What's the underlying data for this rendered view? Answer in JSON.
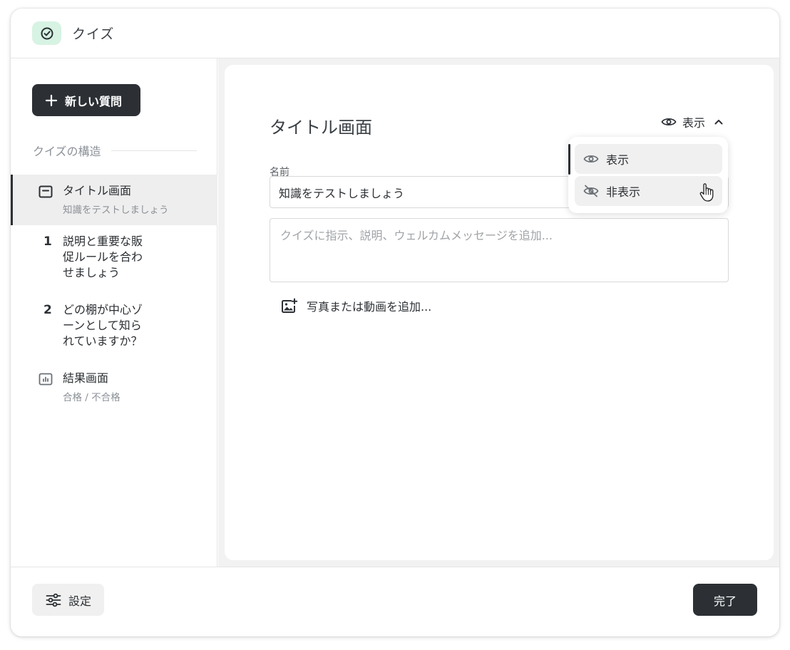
{
  "app": {
    "title": "クイズ",
    "accent": "#d7f3e3"
  },
  "sidebar": {
    "new_question_label": "新しい質問",
    "structure_label": "クイズの構造",
    "items": [
      {
        "title": "タイトル画面",
        "subtitle": "知識をテストしましょう",
        "icon": "title-screen-icon",
        "active": true
      },
      {
        "number": "1",
        "title_lines": [
          "説明と重要な販",
          "促ルールを合わ",
          "せましょう"
        ]
      },
      {
        "number": "2",
        "title_lines": [
          "どの棚が中心ゾ",
          "ーンとして知ら",
          "れていますか？"
        ]
      },
      {
        "title": "結果画面",
        "subtitle": "合格 / 不合格",
        "icon": "results-chart-icon"
      }
    ]
  },
  "main": {
    "title": "タイトル画面",
    "visibility_label": "表示",
    "name_label": "名前",
    "name_value": "知識をテストしましょう",
    "description_placeholder": "クイズに指示、説明、ウェルカムメッセージを追加...",
    "add_media_label": "写真または動画を追加..."
  },
  "visibility_menu": {
    "options": [
      {
        "label": "表示",
        "icon": "eye-icon"
      },
      {
        "label": "非表示",
        "icon": "eye-off-icon"
      }
    ]
  },
  "footer": {
    "settings_label": "設定",
    "done_label": "完了"
  }
}
